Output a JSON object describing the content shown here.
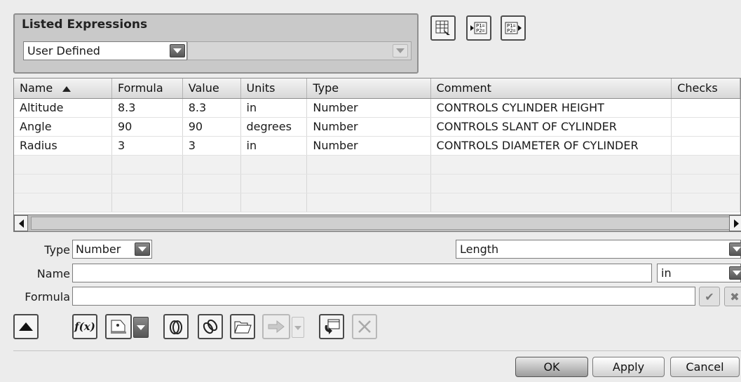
{
  "group": {
    "title": "Listed Expressions",
    "filter_value": "User Defined",
    "secondary_value": ""
  },
  "table": {
    "columns": [
      "Name",
      "Formula",
      "Value",
      "Units",
      "Type",
      "Comment",
      "Checks"
    ],
    "rows": [
      {
        "name": "Altitude",
        "formula": "8.3",
        "value": "8.3",
        "units": "in",
        "type": "Number",
        "comment": "CONTROLS CYLINDER HEIGHT",
        "checks": ""
      },
      {
        "name": "Angle",
        "formula": "90",
        "value": "90",
        "units": "degrees",
        "type": "Number",
        "comment": "CONTROLS SLANT OF CYLINDER",
        "checks": ""
      },
      {
        "name": "Radius",
        "formula": "3",
        "value": "3",
        "units": "in",
        "type": "Number",
        "comment": "CONTROLS DIAMETER OF CYLINDER",
        "checks": ""
      }
    ]
  },
  "editor": {
    "type_label": "Type",
    "type_value": "Number",
    "dimension_value": "Length",
    "name_label": "Name",
    "name_value": "",
    "units_value": "in",
    "formula_label": "Formula",
    "formula_value": ""
  },
  "toolbar": {
    "fx_label": "f(x)"
  },
  "buttons": {
    "ok": "OK",
    "apply": "Apply",
    "cancel": "Cancel"
  }
}
